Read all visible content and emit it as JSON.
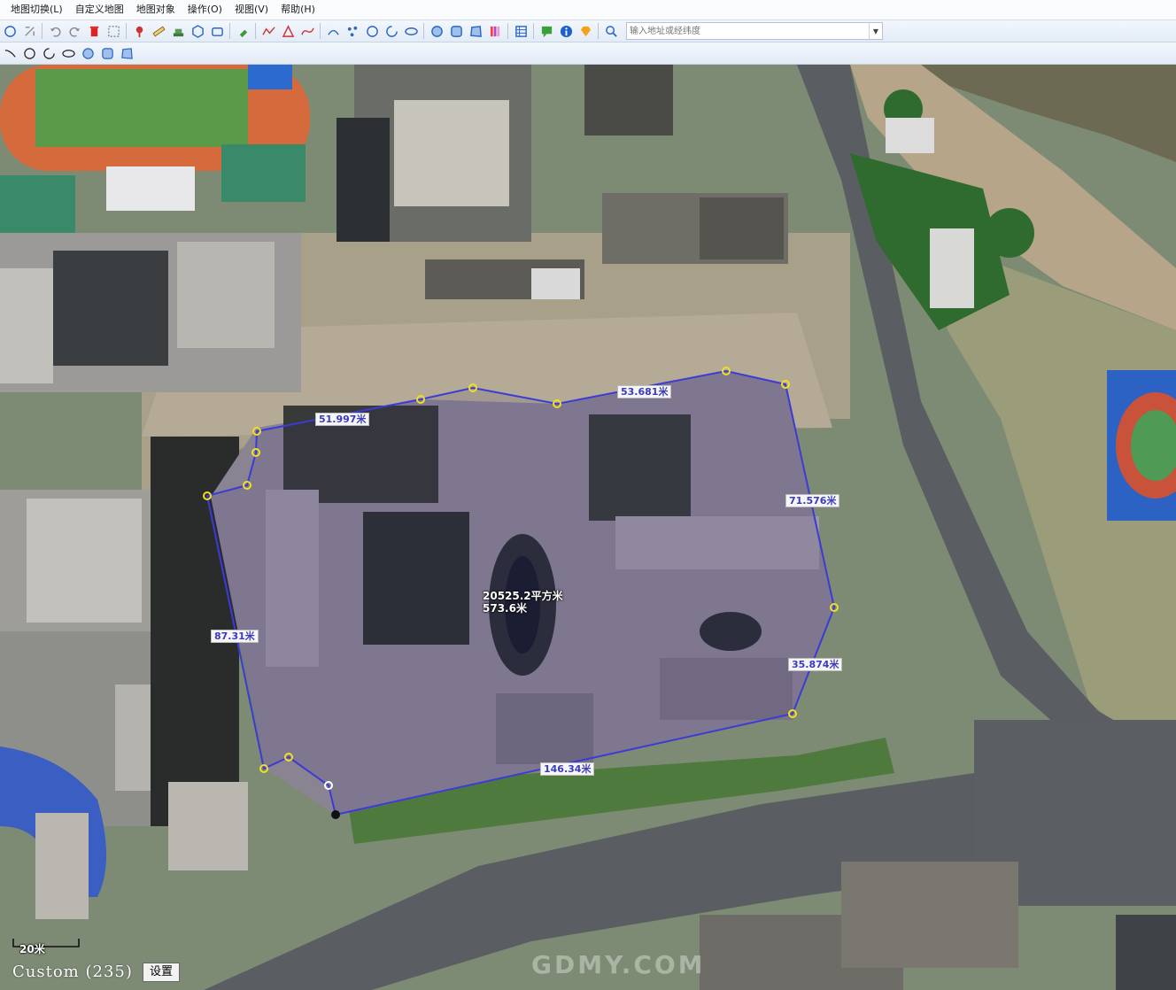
{
  "menu": {
    "items": [
      "地图切换(L)",
      "自定义地图",
      "地图对象",
      "操作(O)",
      "视图(V)",
      "帮助(H)"
    ]
  },
  "toolbar": {
    "search_placeholder": "输入地址或经纬度"
  },
  "measurement": {
    "area": "20525.2平方米",
    "perimeter": "573.6米",
    "edges": [
      "51.997米",
      "53.681米",
      "71.576米",
      "35.874米",
      "146.34米",
      "87.31米"
    ]
  },
  "status": {
    "scale": "20米",
    "map_source": "Custom (235)",
    "settings_label": "设置",
    "watermark": "GDMY.COM"
  },
  "colors": {
    "polygon": "#3b3bd6",
    "vertex": "#f0e020",
    "road": "#5a5e62"
  }
}
